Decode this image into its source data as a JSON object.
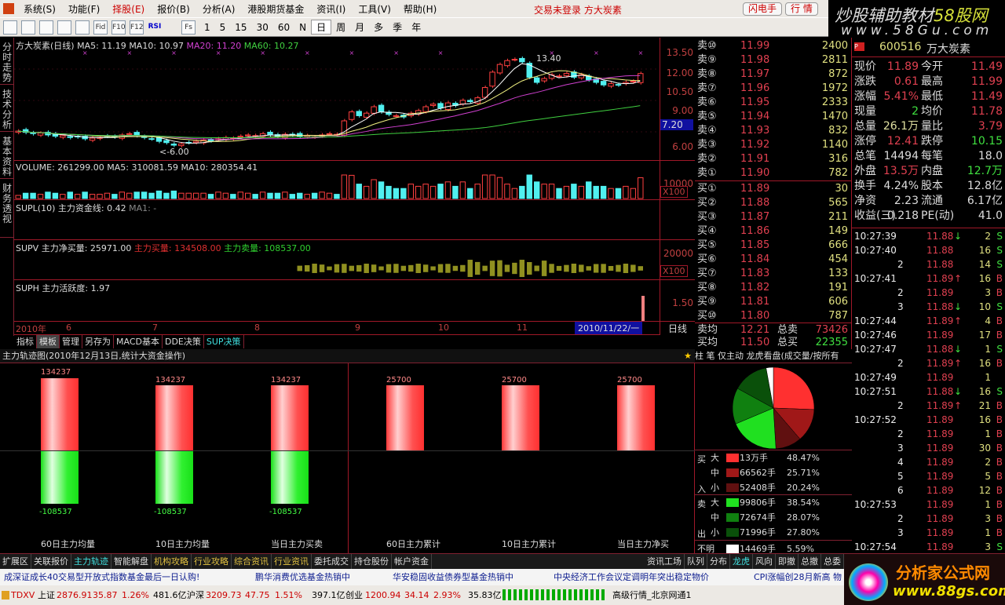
{
  "menu": {
    "items": [
      "系统(S)",
      "功能(F)",
      "择股(E)",
      "报价(B)",
      "分析(A)",
      "港股期货基金",
      "资讯(I)",
      "工具(V)",
      "帮助(H)"
    ],
    "login_status": "交易未登录 方大炭素",
    "flash_trade": "闪电手",
    "quotes": "行 情"
  },
  "toolbar": {
    "icons": [
      "Fid",
      "F10",
      "F12",
      "RSI"
    ],
    "periods": [
      "1",
      "5",
      "15",
      "30",
      "60",
      "N"
    ],
    "cycles": [
      "日",
      "周",
      "月",
      "多",
      "季",
      "年"
    ],
    "fs": "Fs"
  },
  "watermark_top": {
    "line1a": "炒股辅助教材",
    "line1b": "58股网",
    "line2": "www.58Gu.com"
  },
  "vtabs": [
    "分时走势",
    "技术分析",
    "基本资料",
    "财务透视"
  ],
  "kline": {
    "title": "方大炭素(日线)",
    "ma5": "MA5: 11.19",
    "ma10": "MA10: 10.97",
    "ma20": "MA20: 11.20",
    "ma60": "MA60: 10.27",
    "high_label": "13.40",
    "low_label": "<-6.00",
    "axis": [
      "13.50",
      "12.00",
      "10.50",
      "9.00",
      "7.20",
      "6.00"
    ],
    "closes": [
      7.4,
      7.3,
      7.2,
      7.25,
      7.1,
      7.0,
      7.05,
      6.9,
      6.95,
      6.8,
      6.85,
      6.9,
      7.0,
      6.95,
      7.1,
      7.2,
      7.05,
      6.9,
      6.8,
      6.6,
      6.5,
      6.3,
      6.4,
      6.5,
      6.6,
      6.7,
      6.65,
      6.8,
      6.9,
      6.85,
      7.0,
      7.1,
      7.05,
      7.2,
      7.1,
      7.0,
      7.15,
      7.1,
      7.0,
      7.05,
      6.95,
      7.1,
      7.2,
      7.15,
      8.2,
      8.9,
      8.6,
      8.8,
      9.3,
      8.9,
      8.7,
      8.6,
      8.5,
      8.8,
      9.0,
      9.3,
      9.5,
      9.2,
      9.6,
      9.4,
      9.8,
      9.7,
      10.0,
      10.8,
      12.0,
      12.6,
      12.9,
      13.0,
      12.8,
      11.6,
      11.2,
      11.5,
      11.8,
      11.7,
      11.9,
      11.6,
      11.8,
      11.4,
      11.2,
      11.0,
      11.1,
      11.0,
      11.2,
      11.3,
      11.89
    ]
  },
  "volume": {
    "title": "VOLUME: 261299.00 MA5: 310081.59 MA10: 280354.41",
    "axis": "10000",
    "unit": "X100"
  },
  "supl": {
    "title": "SUPL(10) 主力资金线: 0.42",
    "ma": "MA1: -"
  },
  "supv": {
    "title": "SUPV 主力净买量: 25971.00",
    "buy": "主力买量: 134508.00",
    "sell": "主力卖量: 108537.00",
    "axis": "20000",
    "unit": "X100"
  },
  "suph": {
    "title": "SUPH 主力活跃度: 1.97",
    "axis": "1.50"
  },
  "dates": {
    "labels": [
      "2010年",
      "6",
      "7",
      "8",
      "9",
      "10",
      "11"
    ],
    "cursor": "2010/11/22/一",
    "period": "日线"
  },
  "ktabs": [
    "指标",
    "模板",
    "管理",
    "另存为",
    "MACD基本",
    "DDE决策",
    "SUP决策"
  ],
  "track": {
    "title": "主力轨迹图(2010年12月13日,统计大资金操作)",
    "left": [
      {
        "label": "60日主力均量",
        "buy": "134237",
        "sell": "-108537"
      },
      {
        "label": "10日主力均量",
        "buy": "134237",
        "sell": "-108537"
      },
      {
        "label": "当日主力买卖",
        "buy": "134237",
        "sell": "-108537"
      }
    ],
    "right": [
      {
        "label": "60日主力累计",
        "value": "25700"
      },
      {
        "label": "10日主力累计",
        "value": "25700"
      },
      {
        "label": "当日主力净买",
        "value": "25700"
      }
    ]
  },
  "book": {
    "asks": [
      [
        "卖⑩",
        "11.99",
        "2400"
      ],
      [
        "卖⑨",
        "11.98",
        "2811"
      ],
      [
        "卖⑧",
        "11.97",
        "872"
      ],
      [
        "卖⑦",
        "11.96",
        "1972"
      ],
      [
        "卖⑥",
        "11.95",
        "2333"
      ],
      [
        "卖⑤",
        "11.94",
        "1470"
      ],
      [
        "卖④",
        "11.93",
        "832"
      ],
      [
        "卖③",
        "11.92",
        "1140"
      ],
      [
        "卖②",
        "11.91",
        "316"
      ],
      [
        "卖①",
        "11.90",
        "782"
      ]
    ],
    "bids": [
      [
        "买①",
        "11.89",
        "30"
      ],
      [
        "买②",
        "11.88",
        "565"
      ],
      [
        "买③",
        "11.87",
        "211"
      ],
      [
        "买④",
        "11.86",
        "149"
      ],
      [
        "买⑤",
        "11.85",
        "666"
      ],
      [
        "买⑥",
        "11.84",
        "454"
      ],
      [
        "买⑦",
        "11.83",
        "133"
      ],
      [
        "买⑧",
        "11.82",
        "191"
      ],
      [
        "买⑨",
        "11.81",
        "606"
      ],
      [
        "买⑩",
        "11.80",
        "787"
      ]
    ],
    "ask_avg_label": "卖均",
    "ask_avg": "12.21",
    "total_sell_label": "总卖",
    "total_sell": "73426",
    "bid_avg_label": "买均",
    "bid_avg": "11.50",
    "total_buy_label": "总买",
    "total_buy": "22355"
  },
  "quote": {
    "code": "600516",
    "name": "万大炭素",
    "rows": [
      [
        "现价",
        "11.89",
        "今开",
        "11.49"
      ],
      [
        "涨跌",
        "0.61",
        "最高",
        "11.99"
      ],
      [
        "涨幅",
        "5.41%",
        "最低",
        "11.49"
      ],
      [
        "现量",
        "2",
        "均价",
        "11.78"
      ],
      [
        "总量",
        "26.1万",
        "量比",
        "3.79"
      ],
      [
        "涨停",
        "12.41",
        "跌停",
        "10.15"
      ],
      [
        "总笔",
        "14494",
        "每笔",
        "18.0"
      ],
      [
        "外盘",
        "13.5万",
        "内盘",
        "12.7万"
      ],
      [
        "换手",
        "4.24%",
        "股本",
        "12.8亿"
      ],
      [
        "净资",
        "2.23",
        "流通",
        "6.17亿"
      ],
      [
        "收益(三)",
        "0.218",
        "PE(动)",
        "41.0"
      ]
    ]
  },
  "ticks": [
    [
      "10:27:39",
      "11.88",
      "↓",
      "2",
      "S"
    ],
    [
      "10:27:40",
      "11.88",
      "",
      "16",
      "S"
    ],
    [
      "2",
      "11.88",
      "",
      "14",
      "S"
    ],
    [
      "10:27:41",
      "11.89",
      "↑",
      "16",
      "B"
    ],
    [
      "2",
      "11.89",
      "",
      "3",
      "B"
    ],
    [
      "3",
      "11.88",
      "↓",
      "10",
      "S"
    ],
    [
      "10:27:44",
      "11.89",
      "↑",
      "4",
      "B"
    ],
    [
      "10:27:46",
      "11.89",
      "",
      "17",
      "B"
    ],
    [
      "10:27:47",
      "11.88",
      "↓",
      "1",
      "S"
    ],
    [
      "2",
      "11.89",
      "↑",
      "16",
      "B"
    ],
    [
      "10:27:49",
      "11.89",
      "",
      "1",
      ""
    ],
    [
      "10:27:51",
      "11.88",
      "↓",
      "16",
      "S"
    ],
    [
      "2",
      "11.89",
      "↑",
      "21",
      "B"
    ],
    [
      "10:27:52",
      "11.89",
      "",
      "16",
      "B"
    ],
    [
      "2",
      "11.89",
      "",
      "1",
      "B"
    ],
    [
      "3",
      "11.89",
      "",
      "30",
      "B"
    ],
    [
      "4",
      "11.89",
      "",
      "2",
      "B"
    ],
    [
      "5",
      "11.89",
      "",
      "5",
      "B"
    ],
    [
      "6",
      "11.89",
      "",
      "12",
      "B"
    ],
    [
      "10:27:53",
      "11.89",
      "",
      "1",
      "B"
    ],
    [
      "2",
      "11.89",
      "",
      "3",
      "B"
    ],
    [
      "3",
      "11.89",
      "",
      "1",
      "B"
    ],
    [
      "10:27:54",
      "11.89",
      "",
      "3",
      "S"
    ]
  ],
  "pie": {
    "tabs": "柱 笔 仅主动 龙虎看盘(成交量/按所有",
    "buy_label": [
      "买",
      "入"
    ],
    "sell_label": [
      "卖",
      "出"
    ],
    "rows": [
      {
        "size": "大",
        "amount": "13万手",
        "pct": "48.47%",
        "value": 130000,
        "color": "#ff3030"
      },
      {
        "size": "中",
        "amount": "66562手",
        "pct": "25.71%",
        "value": 66562,
        "color": "#a01818"
      },
      {
        "size": "小",
        "amount": "52408手",
        "pct": "20.24%",
        "value": 52408,
        "color": "#601010"
      },
      {
        "size": "大",
        "amount": "99806手",
        "pct": "38.54%",
        "value": 99806,
        "color": "#20e020"
      },
      {
        "size": "中",
        "amount": "72674手",
        "pct": "28.07%",
        "value": 72674,
        "color": "#108010"
      },
      {
        "size": "小",
        "amount": "71996手",
        "pct": "27.80%",
        "value": 71996,
        "color": "#0a500a"
      },
      {
        "size": "不明",
        "amount": "14469手",
        "pct": "5.59%",
        "value": 14469,
        "color": "#ffffff"
      }
    ]
  },
  "bottom_tabs": [
    "扩展区",
    "关联报价",
    "主力轨迹",
    "智能解盘",
    "机构攻略",
    "行业攻略",
    "综合资讯",
    "行业资讯",
    "委托成交",
    "持仓股份",
    "帐户资金"
  ],
  "bottom_tabs_right": [
    "资讯工场",
    "队列",
    "分布",
    "龙虎",
    "风向",
    "即撤",
    "总撤",
    "总委"
  ],
  "news": [
    "成深证成长40交易型开放式指数基金最后一日认购!",
    "鹏华消费优选基金热销中",
    "华安稳固收益债券型基金热销中",
    "中央经济工作会议定调明年突出稳定物价",
    "CPI涨幅创28月新高 物"
  ],
  "status": {
    "brand": "TDXV",
    "sh_label": "上证",
    "sh": "2876.91",
    "sh_chg": "35.87",
    "sh_pct": "1.26%",
    "sh_amt": "481.6亿",
    "sz_label": "沪深",
    "sz": "3209.73",
    "sz_chg": "47.75",
    "sz_pct": "1.51%",
    "sz_amt": "397.1亿",
    "cy_label": "创业",
    "cy": "1200.94",
    "cy_chg": "34.14",
    "cy_pct": "2.93%",
    "cy_amt": "35.83亿",
    "server": "高级行情_北京网通1"
  },
  "watermark_bottom": {
    "line1": "分析家公式网",
    "line2": "www.88gs.com"
  }
}
